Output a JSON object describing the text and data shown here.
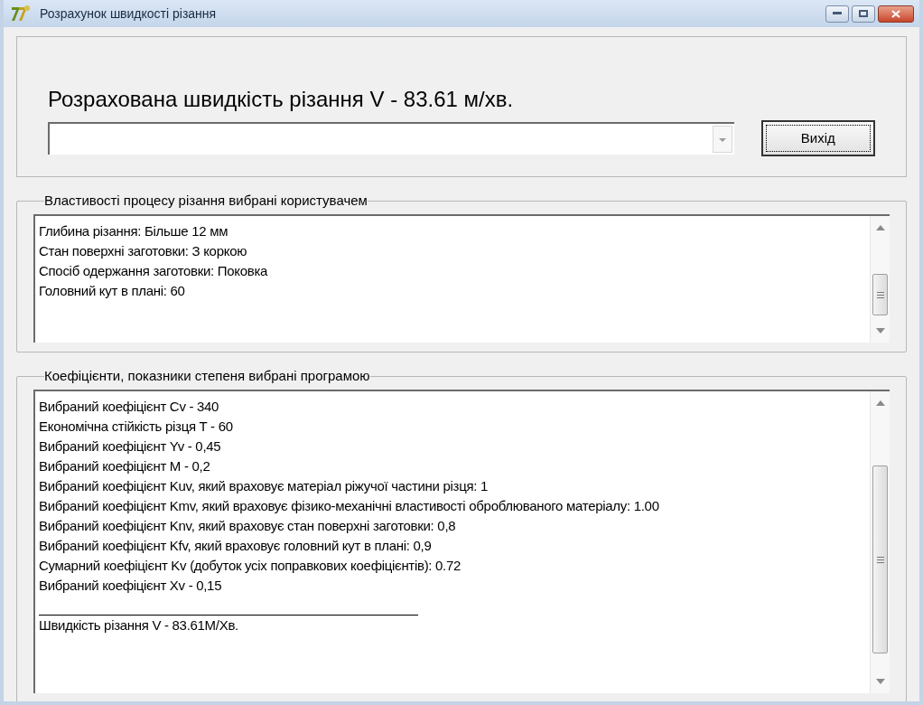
{
  "window": {
    "title": "Розрахунок швидкості різання"
  },
  "result": {
    "heading": "Розрахована швидкість різання V - 83.61 м/хв.",
    "button": "Вихід"
  },
  "user_properties": {
    "legend": "Властивості процесу різання вибрані користувачем",
    "lines": [
      {
        "kind": "text",
        "text": "Глибина різання: Більше 12 мм"
      },
      {
        "kind": "text",
        "text": "Стан поверхні заготовки: З коркою"
      },
      {
        "kind": "text",
        "text": "Спосіб одержання заготовки: Поковка"
      },
      {
        "kind": "text",
        "text": "Головний кут в плані: 60"
      }
    ]
  },
  "program_coefficients": {
    "legend": "Коефіцієнти, показники степеня вибрані програмою",
    "lines": [
      {
        "kind": "text",
        "text": "Вибраний коефіцієнт Cv - 340"
      },
      {
        "kind": "text",
        "text": "Економічна стійкість різця T - 60"
      },
      {
        "kind": "text",
        "text": "Вибраний коефіцієнт Yv - 0,45"
      },
      {
        "kind": "text",
        "text": "Вибраний коефіцієнт M - 0,2"
      },
      {
        "kind": "text",
        "text": "Вибраний коефіцієнт Kuv, який враховує матеріал ріжучої частини різця: 1"
      },
      {
        "kind": "text",
        "text": "Вибраний коефіцієнт Kmv, який враховує фізико-механічні властивості оброблюваного матеріалу: 1.00"
      },
      {
        "kind": "text",
        "text": "Вибраний коефіцієнт Knv, який враховує стан поверхні заготовки: 0,8"
      },
      {
        "kind": "text",
        "text": "Вибраний коефіцієнт Kfv, який враховує головний кут в плані: 0,9"
      },
      {
        "kind": "text",
        "text": "Сумарний коефіцієнт Kv (добуток усіх поправкових коефіцієнтів): 0.72"
      },
      {
        "kind": "text",
        "text": "Вибраний коефіцієнт Xv - 0,15"
      },
      {
        "kind": "rule"
      },
      {
        "kind": "text",
        "text": "Швидкість різання V - 83.61M/Xв."
      }
    ]
  }
}
